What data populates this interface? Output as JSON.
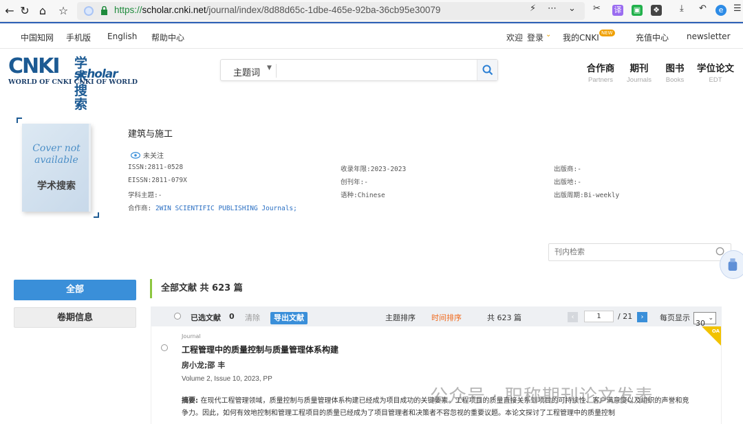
{
  "browser": {
    "url_scheme": "https://",
    "url_host": "scholar.cnki.net",
    "url_path": "/journal/index/8d88d65c-1dbe-465e-92ba-36cb95e30079"
  },
  "topbar": {
    "cnki_china": "中国知网",
    "mobile": "手机版",
    "english": "English",
    "help": "帮助中心",
    "welcome": "欢迎",
    "login": "登录",
    "my_cnki": "我的CNKI",
    "new_badge": "NEW",
    "recharge": "充值中心",
    "newsletter": "newsletter"
  },
  "logo": {
    "main": "CNKI",
    "cn": "学术搜索",
    "sub": "scholar",
    "tagline": "WORLD OF CNKI CNKI OF WORLD"
  },
  "search": {
    "type": "主题词",
    "placeholder": ""
  },
  "header_nav": [
    {
      "cn": "合作商",
      "en": "Partners"
    },
    {
      "cn": "期刊",
      "en": "Journals"
    },
    {
      "cn": "图书",
      "en": "Books"
    },
    {
      "cn": "学位论文",
      "en": "EDT"
    }
  ],
  "cover": {
    "line1": "Cover not",
    "line2": "available",
    "logo": "学术搜索"
  },
  "journal": {
    "title": "建筑与施工",
    "follow": "未关注",
    "issn": "ISSN:2811-0528",
    "eissn": "EISSN:2811-079X",
    "subject": "学科主题:-",
    "partner_label": "合作商: ",
    "partner": "2WIN SCIENTIFIC PUBLISHING Journals;",
    "years": "收录年限:2023-2023",
    "founded": "创刊年:-",
    "language": "语种:Chinese",
    "publisher": "出版商:-",
    "place": "出版地:-",
    "cycle": "出版周期:Bi-weekly"
  },
  "inner_search": {
    "placeholder": "刊内检索"
  },
  "sidebar": {
    "all": "全部",
    "issues": "卷期信息"
  },
  "results": {
    "header": "全部文献 共 623 篇",
    "selected_label": "已选文献",
    "selected_count": "0",
    "clear": "清除",
    "export": "导出文献",
    "sort_topic": "主题排序",
    "sort_time": "时间排序",
    "total": "共 623 篇",
    "page_current": "1",
    "page_total": "/ 21",
    "per_page_label": "每页显示",
    "per_page": "30"
  },
  "articles": [
    {
      "type": "Journal",
      "title": "工程管理中的质量控制与质量管理体系构建",
      "authors": "房小龙;邵 丰",
      "volume": "Volume 2, Issue 10, 2023, PP",
      "abstract_label": "摘要: ",
      "abstract": "在现代工程管理领域，质量控制与质量管理体系构建已经成为项目成功的关键要素。工程项目的质量直接关系到项目的可持续性、客户满意度以及组织的声誉和竞争力。因此，如何有效地控制和管理工程项目的质量已经成为了项目管理者和决策者不容忽视的重要议题。本论文探讨了工程管理中的质量控制",
      "oa": "OA"
    }
  ],
  "watermark": "公众号 · 职称期刊论文发表",
  "colors": {
    "brand": "#1c5a93",
    "accent": "#3a8fd9",
    "active_sort": "#f06a1e",
    "green_bar": "#8cc63f",
    "oa": "#f2c200"
  }
}
